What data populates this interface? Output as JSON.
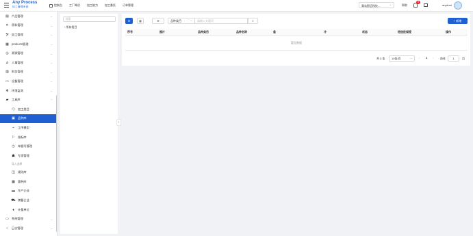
{
  "header": {
    "logo_name": "Any Process",
    "logo_sub": "加工管理系统",
    "nav": [
      "控制台",
      "工厂概况",
      "加工能力",
      "加工委托",
      "订单管理"
    ],
    "factory_select": "青岛那迈科技...",
    "help": "帮助",
    "notification_count": "9",
    "username": "anyfemi"
  },
  "sidebar": {
    "items": [
      {
        "label": "产品管理",
        "icon": "▤",
        "chevron": "⌄"
      },
      {
        "label": "原料管理",
        "icon": "✕",
        "chevron": "⌄"
      },
      {
        "label": "加工管理",
        "icon": "⚒",
        "chevron": "⌄"
      },
      {
        "label": "products管理",
        "icon": "▦",
        "chevron": "⌄"
      },
      {
        "label": "溯源管理",
        "icon": "◎",
        "chevron": "⌄"
      },
      {
        "label": "人事管理",
        "icon": "♙",
        "chevron": "⌄"
      },
      {
        "label": "财务管理",
        "icon": "▥",
        "chevron": "⌄"
      },
      {
        "label": "设备管理",
        "icon": "▭",
        "chevron": "⌄"
      },
      {
        "label": "环境监测",
        "icon": "✻",
        "chevron": "⌄"
      },
      {
        "label": "工具库",
        "icon": "▰",
        "chevron": "⌃"
      }
    ],
    "sub_items": [
      {
        "label": "加工类目",
        "icon": "⬡"
      },
      {
        "label": "品种库",
        "icon": "▣",
        "active": true
      },
      {
        "label": "工序模型",
        "icon": "⌁"
      },
      {
        "label": "指标库",
        "icon": "⚐"
      },
      {
        "label": "单据号管理",
        "icon": "◷"
      },
      {
        "label": "专家管理",
        "icon": "☗"
      }
    ],
    "group_label": "导入选择",
    "group_items": [
      {
        "label": "规则库",
        "icon": "◫"
      },
      {
        "label": "菌种库",
        "icon": "▩"
      },
      {
        "label": "生产企业",
        "icon": "▬"
      },
      {
        "label": "储备企业",
        "icon": "⛟"
      },
      {
        "label": "计量单位",
        "icon": "♦"
      }
    ],
    "bottom_items": [
      {
        "label": "系统管理",
        "icon": "▭",
        "chevron": "⌄"
      },
      {
        "label": "日志管理",
        "icon": "○",
        "chevron": "⌄"
      }
    ]
  },
  "tree": {
    "search_placeholder": "搜索",
    "root_node": "所有类目"
  },
  "toolbar": {
    "field_select": "品种类目",
    "search_placeholder": "请输入关键词",
    "add_button": "新增"
  },
  "table": {
    "columns": [
      "序号",
      "图片",
      "品种类目",
      "品种名称",
      "备",
      "冷",
      "状态",
      "短信投保提",
      "操作"
    ],
    "empty_text": "暂无数据"
  },
  "pagination": {
    "total": "共 0 条",
    "page_size": "10条/页",
    "current_page": "1",
    "goto_label": "前往",
    "goto_value": "1",
    "unit": "页"
  },
  "colors": {
    "primary": "#1f5fd1",
    "background": "#f0f2f5",
    "badge": "#f5222d"
  }
}
